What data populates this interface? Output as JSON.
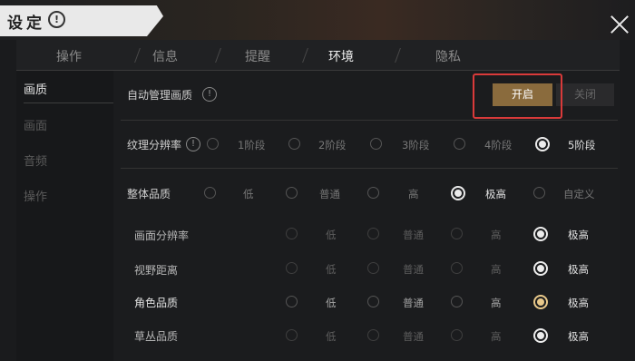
{
  "header": {
    "title": "设定",
    "info_glyph": "!"
  },
  "tabs": [
    {
      "label": "操作",
      "active": false
    },
    {
      "label": "信息",
      "active": false
    },
    {
      "label": "提醒",
      "active": false
    },
    {
      "label": "环境",
      "active": true
    },
    {
      "label": "隐私",
      "active": false
    }
  ],
  "sidebar": {
    "items": [
      {
        "label": "画质",
        "active": true
      },
      {
        "label": "画面",
        "active": false
      },
      {
        "label": "音频",
        "active": false
      },
      {
        "label": "操作",
        "active": false
      }
    ]
  },
  "auto_quality": {
    "label": "自动管理画质",
    "info_glyph": "!",
    "on_label": "开启",
    "off_label": "关闭",
    "state": "开启"
  },
  "texture": {
    "label": "纹理分辨率",
    "info_glyph": "!",
    "options": [
      "1阶段",
      "2阶段",
      "3阶段",
      "4阶段",
      "5阶段"
    ],
    "selected": "5阶段"
  },
  "overall": {
    "label": "整体品质",
    "options": [
      "低",
      "普通",
      "高",
      "极高",
      "自定义"
    ],
    "selected": "极高"
  },
  "sub_settings": [
    {
      "label": "画面分辨率",
      "options": [
        "低",
        "普通",
        "高",
        "极高"
      ],
      "selected": "极高"
    },
    {
      "label": "视野距离",
      "options": [
        "低",
        "普通",
        "高",
        "极高"
      ],
      "selected": "极高"
    },
    {
      "label": "角色品质",
      "options": [
        "低",
        "普通",
        "高",
        "极高"
      ],
      "selected": "极高"
    },
    {
      "label": "草丛品质",
      "options": [
        "低",
        "普通",
        "高",
        "极高"
      ],
      "selected": "极高"
    }
  ],
  "colors": {
    "accent_gold": "#8a6b3d",
    "selected_gold": "#e9c98a",
    "highlight_red": "#d93a3a",
    "background": "#1b1c1e"
  }
}
